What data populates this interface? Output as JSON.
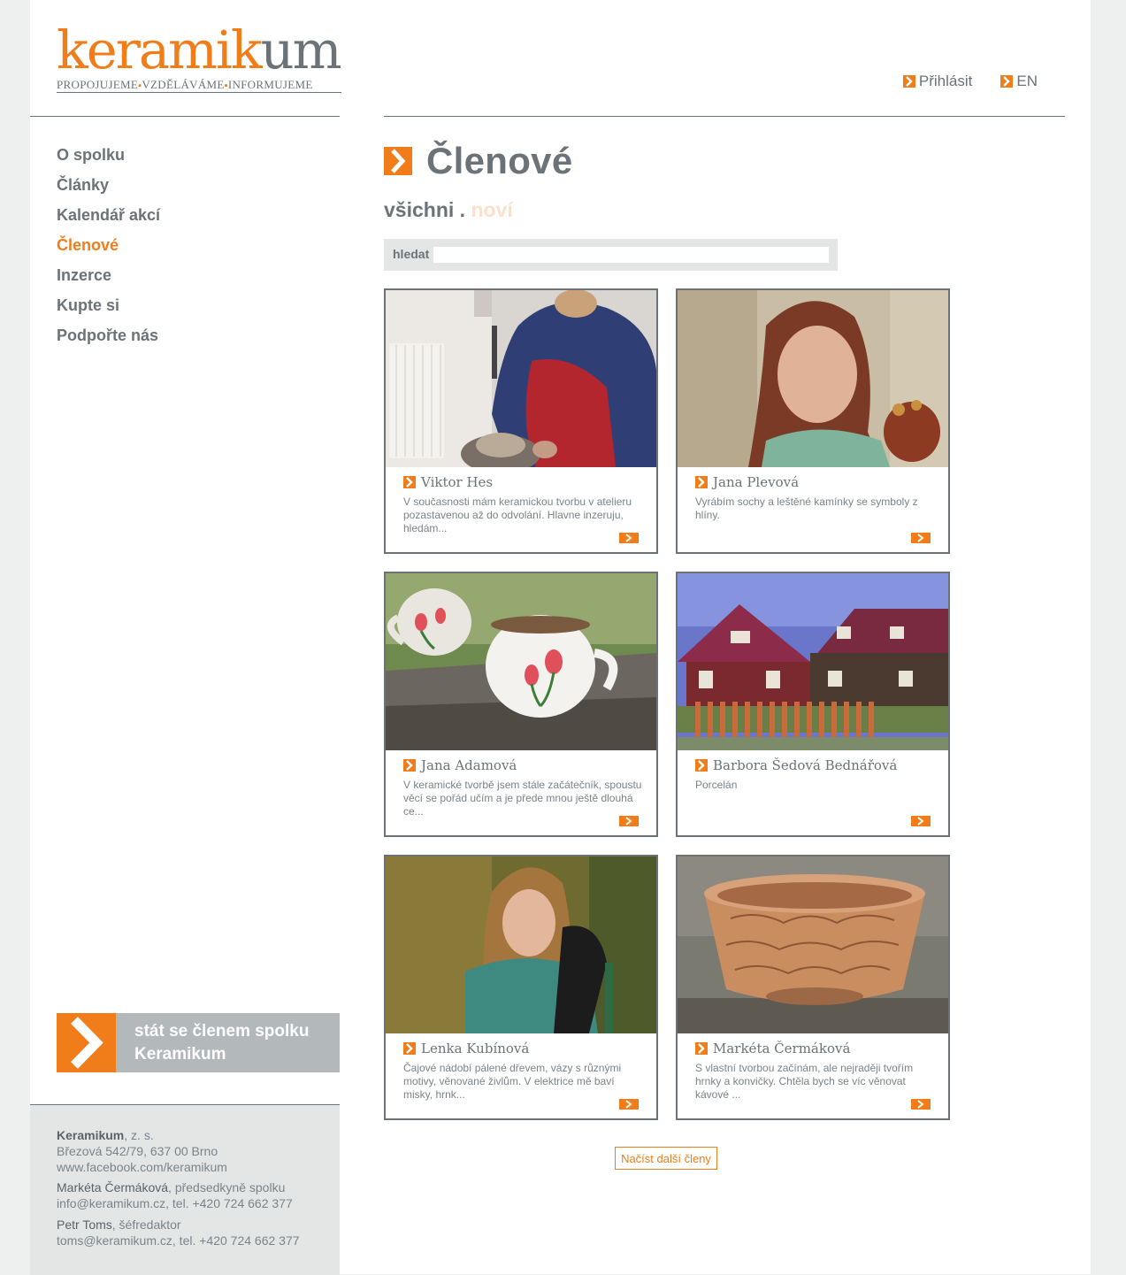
{
  "logo": {
    "word_orange_1": "kerami",
    "word_orange_2": "k",
    "word_grey": "um",
    "tag_1": "PROPOJUJEME",
    "tag_2": "VZDĚLÁVÁME",
    "tag_3": "INFORMUJEME"
  },
  "nav": [
    "O spolku",
    "Články",
    "Kalendář akcí",
    "Členové",
    "Inzerce",
    "Kupte si",
    "Podpořte nás"
  ],
  "nav_active": "Členové",
  "header": {
    "login": "Přihlásit",
    "lang": "EN"
  },
  "page": {
    "title": "Členové",
    "filter_all": "všichni",
    "filter_sep": ".",
    "filter_new": "noví"
  },
  "search": {
    "label": "hledat",
    "value": "",
    "placeholder": ""
  },
  "members": [
    {
      "name": "Viktor Hes",
      "desc": "V současnosti mám keramickou tvorbu v atelieru pozastavenou až do odvolání. Hlavne inzeruju, hledám..."
    },
    {
      "name": "Jana Plevová",
      "desc": "Vyrábím sochy a leštěné kamínky se symboly z hlíny."
    },
    {
      "name": "Jana Adamová",
      "desc": "V keramické tvorbě jsem stále začátečník, spoustu věcí se pořád učím a je přede mnou ještě dlouhá ce..."
    },
    {
      "name": "Barbora Šedová Bednářová",
      "desc": "Porcelán"
    },
    {
      "name": "Lenka Kubínová",
      "desc": "Čajové nádobí pálené dřevem, vázy s různými motivy, věnované živlům. V elektrice mě baví misky, hrnk..."
    },
    {
      "name": "Markéta Čermáková",
      "desc": "S vlastní tvorbou začínám, ale nejraději tvořím hrnky a konvičky. Chtěla bych se víc věnovat kávové ..."
    }
  ],
  "load_more": "Načíst další členy",
  "join": {
    "line1": "stát se členem spolku",
    "line2": "Keramikum"
  },
  "footer": {
    "org_name": "Keramikum",
    "org_suffix": ", z. s.",
    "address": "Březová 542/79, 637 00 Brno",
    "facebook": "www.facebook.com/keramikum",
    "chair_name": "Markéta Čermáková",
    "chair_role": ", předsedkyně spolku",
    "chair_contact": "info@keramikum.cz, tel. +420 724 662 377",
    "editor_name": "Petr Toms",
    "editor_role": ", šéfredaktor",
    "editor_contact": "toms@keramikum.cz, tel. +420 724 662 377"
  },
  "colors": {
    "accent": "#f07d1a",
    "text": "#6b7379",
    "panel": "#e3e6e5",
    "join_bg": "#b3b8bb",
    "filter_inactive": "#fbe0cb"
  }
}
